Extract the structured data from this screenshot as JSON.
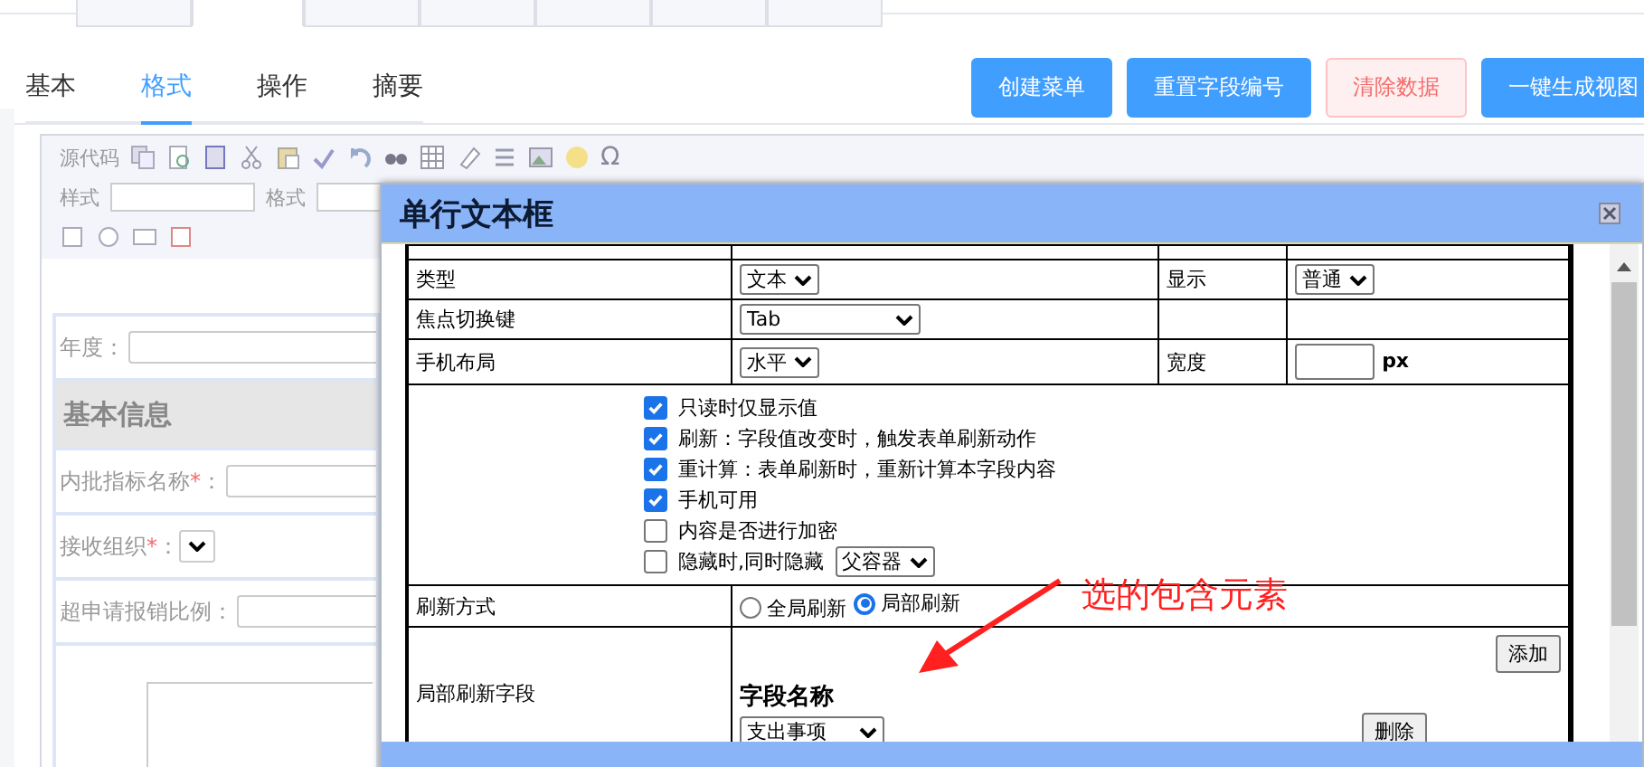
{
  "top_tabs": [
    {
      "selected": false
    },
    {
      "selected": true
    },
    {
      "selected": false
    },
    {
      "selected": false
    },
    {
      "selected": false
    },
    {
      "selected": false
    },
    {
      "selected": false
    }
  ],
  "sub_tabs": [
    {
      "label": "基本",
      "selected": false
    },
    {
      "label": "格式",
      "selected": true
    },
    {
      "label": "操作",
      "selected": false
    },
    {
      "label": "摘要",
      "selected": false
    }
  ],
  "actions": [
    {
      "label": "创建菜单",
      "kind": "primary"
    },
    {
      "label": "重置字段编号",
      "kind": "primary"
    },
    {
      "label": "清除数据",
      "kind": "danger"
    },
    {
      "label": "一键生成视图",
      "kind": "primary"
    }
  ],
  "editor": {
    "toolbar": {
      "source_label": "源代码",
      "style_label": "样式",
      "format_label": "格式",
      "special_char": "Ω"
    },
    "form": {
      "year": {
        "label": "年度",
        "suffix": "："
      },
      "section_title": "基本信息",
      "fields": [
        {
          "label": "内批指标名称",
          "required_mark": "*",
          "suffix": "：",
          "kind": "text"
        },
        {
          "label": "接收组织",
          "required_mark": "*",
          "suffix": "：",
          "kind": "select"
        },
        {
          "label": "超申请报销比例",
          "suffix": "：",
          "kind": "text"
        }
      ]
    }
  },
  "dialog": {
    "title": "单行文本框",
    "rows": [
      {
        "kind": "pair",
        "label": "类型",
        "value": "文本",
        "label2": "显示",
        "value2": "普通"
      },
      {
        "kind": "select",
        "label": "焦点切换键",
        "value": "Tab"
      },
      {
        "kind": "width",
        "label": "手机布局",
        "value": "水平",
        "label2": "宽度",
        "unit": "px"
      },
      {
        "kind": "options",
        "options": [
          {
            "label": "只读时仅显示值",
            "checked": true
          },
          {
            "label": "刷新：字段值改变时，触发表单刷新动作",
            "checked": true
          },
          {
            "label": "重计算：表单刷新时，重新计算本字段内容",
            "checked": true
          },
          {
            "label": "手机可用",
            "checked": true
          },
          {
            "label": "内容是否进行加密",
            "checked": false
          },
          {
            "label": "隐藏时,同时隐藏",
            "checked": false,
            "select": "父容器"
          }
        ]
      },
      {
        "kind": "radios",
        "label": "刷新方式",
        "choices": [
          {
            "label": "全局刷新",
            "selected": false
          },
          {
            "label": "局部刷新",
            "selected": true
          }
        ]
      },
      {
        "kind": "fields",
        "label": "局部刷新字段",
        "add": "添加",
        "heading": "字段名称",
        "value": "支出事项",
        "remove": "删除"
      }
    ]
  },
  "annotation": {
    "text": "选的包含元素"
  }
}
